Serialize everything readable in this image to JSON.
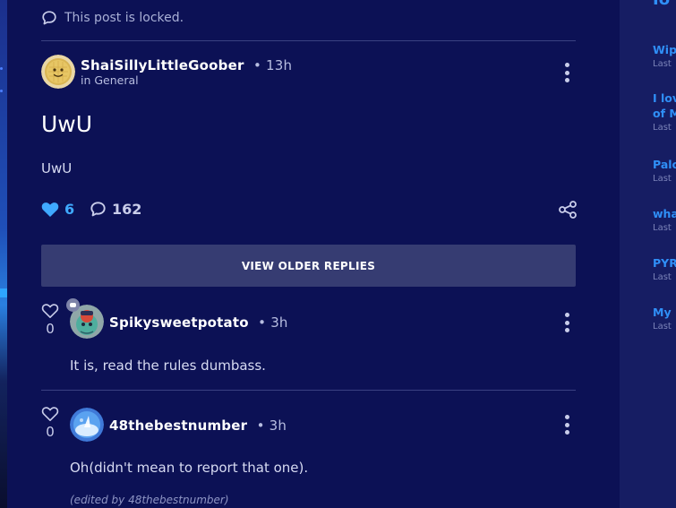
{
  "post": {
    "locked_notice": "This post is locked.",
    "author": "ShaiSillyLittleGoober",
    "separator": "•",
    "time": "13h",
    "category": "in General",
    "title": "UwU",
    "body": "UwU",
    "likes": "6",
    "comments": "162"
  },
  "view_older_label": "VIEW OLDER REPLIES",
  "replies": [
    {
      "author": "Spikysweetpotato",
      "time": "3h",
      "likes": "0",
      "text": "It is, read the rules dumbass."
    },
    {
      "author": "48thebestnumber",
      "time": "3h",
      "likes": "0",
      "text": "Oh(didn't mean to report that one).",
      "edited": "(edited by 48thebestnumber)"
    }
  ],
  "sidebar": {
    "header_fragment": "Io",
    "items": [
      {
        "title": "Wip",
        "meta": "Last"
      },
      {
        "title": "I lov",
        "title2": "of M",
        "meta": "Last"
      },
      {
        "title": "Palo",
        "meta": "Last"
      },
      {
        "title": "wha",
        "meta": "Last"
      },
      {
        "title": "PYR",
        "meta": "Last"
      },
      {
        "title": "My p",
        "meta": "Last"
      }
    ]
  },
  "colors": {
    "background": "#0c1155",
    "sidebar": "#161d63",
    "accent_blue": "#2f8ff7",
    "like_heart": "#3fa9ff",
    "button": "#363c72"
  },
  "icons": {
    "locked": "speech-bubble-icon",
    "like": "heart-icon",
    "comment": "speech-bubble-icon",
    "share": "share-icon",
    "more": "kebab-menu-icon"
  }
}
